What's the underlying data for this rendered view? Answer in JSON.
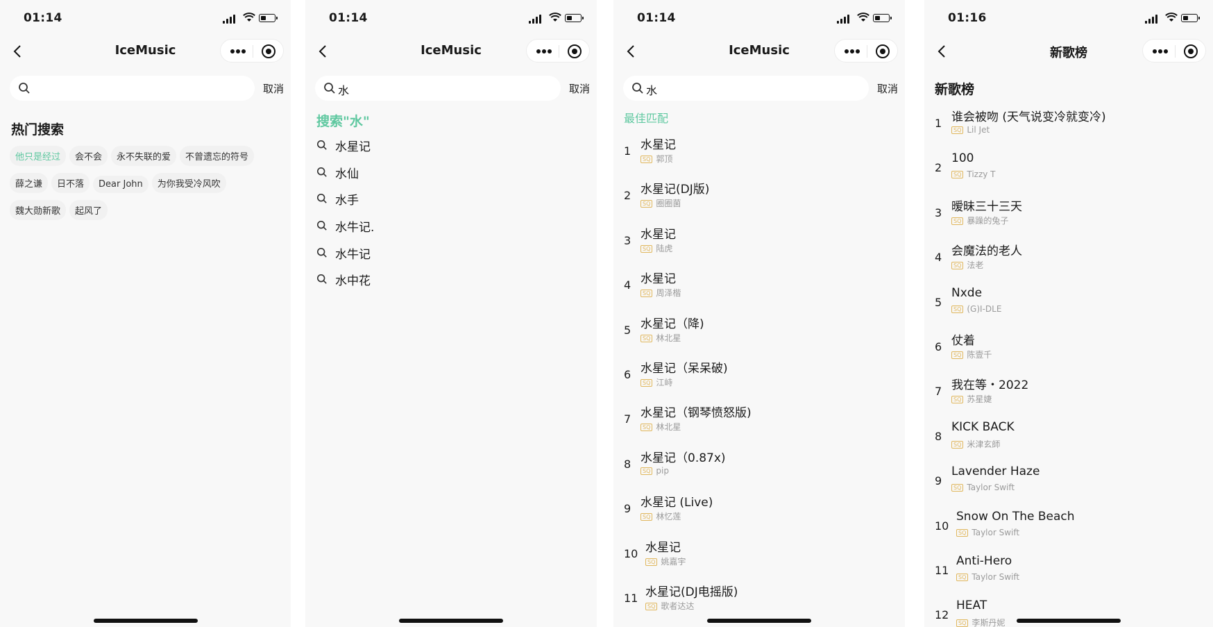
{
  "colors": {
    "accent": "#5fc8a0",
    "sq_badge": "#e0b65b"
  },
  "panels": [
    {
      "time": "01:14",
      "title": "IceMusic",
      "search_value": "",
      "cancel": "取消",
      "hot_title": "热门搜索",
      "hot_tags": [
        "他只是经过",
        "会不会",
        "永不失联的爱",
        "不曾遗忘的符号",
        "薛之谦",
        "日不落",
        "Dear John",
        "为你我受冷风吹",
        "魏大勋新歌",
        "起风了"
      ]
    },
    {
      "time": "01:14",
      "title": "IceMusic",
      "search_value": "水",
      "cancel": "取消",
      "hot_query": "搜索\"水\"",
      "suggestions": [
        "水星记",
        "水仙",
        "水手",
        "水牛记.",
        "水牛记",
        "水中花"
      ]
    },
    {
      "time": "01:14",
      "title": "IceMusic",
      "search_value": "水",
      "cancel": "取消",
      "section": "最佳匹配",
      "badge": "SQ",
      "songs": [
        {
          "rank": "1",
          "name": "水星记",
          "artist": "郭顶"
        },
        {
          "rank": "2",
          "name": "水星记(DJ版)",
          "artist": "圈圈菌"
        },
        {
          "rank": "3",
          "name": "水星记",
          "artist": "陆虎"
        },
        {
          "rank": "4",
          "name": "水星记",
          "artist": "周泽楷"
        },
        {
          "rank": "5",
          "name": "水星记（降)",
          "artist": "林北星"
        },
        {
          "rank": "6",
          "name": "水星记（呆呆破)",
          "artist": "江峙"
        },
        {
          "rank": "7",
          "name": "水星记（钢琴愤怒版)",
          "artist": "林北星"
        },
        {
          "rank": "8",
          "name": "水星记（0.87x)",
          "artist": "pip"
        },
        {
          "rank": "9",
          "name": "水星记 (Live)",
          "artist": "林忆莲"
        },
        {
          "rank": "10",
          "name": "水星记",
          "artist": "姚嘉宇"
        },
        {
          "rank": "11",
          "name": "水星记(DJ电摇版)",
          "artist": "歌者达达"
        }
      ]
    },
    {
      "time": "01:16",
      "title": "新歌榜",
      "section": "新歌榜",
      "badge": "SQ",
      "songs": [
        {
          "rank": "1",
          "name": "谁会被吻 (天气说变冷就变冷)",
          "artist": "Lil Jet"
        },
        {
          "rank": "2",
          "name": "100",
          "artist": "Tizzy T"
        },
        {
          "rank": "3",
          "name": "暧昧三十三天",
          "artist": "暴躁的兔子"
        },
        {
          "rank": "4",
          "name": "会魔法的老人",
          "artist": "法老"
        },
        {
          "rank": "5",
          "name": "Nxde",
          "artist": "(G)I-DLE"
        },
        {
          "rank": "6",
          "name": "仗着",
          "artist": "陈壹千"
        },
        {
          "rank": "7",
          "name": "我在等・2022",
          "artist": "苏星婕"
        },
        {
          "rank": "8",
          "name": "KICK BACK",
          "artist": "米津玄師"
        },
        {
          "rank": "9",
          "name": "Lavender Haze",
          "artist": "Taylor Swift"
        },
        {
          "rank": "10",
          "name": "Snow On The Beach",
          "artist": "Taylor Swift"
        },
        {
          "rank": "11",
          "name": "Anti-Hero",
          "artist": "Taylor Swift"
        },
        {
          "rank": "12",
          "name": "HEAT",
          "artist": "李斯丹妮"
        }
      ]
    }
  ]
}
